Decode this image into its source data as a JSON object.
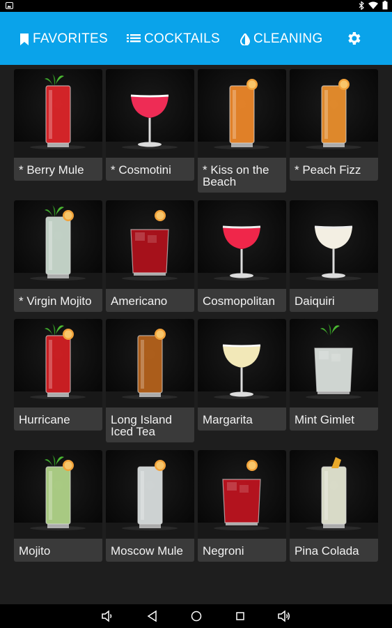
{
  "tabs": [
    {
      "label": "FAVORITES",
      "icon": "bookmark-icon"
    },
    {
      "label": "COCKTAILS",
      "icon": "list-icon"
    },
    {
      "label": "CLEANING",
      "icon": "water-drop-icon"
    }
  ],
  "settings_icon": "gear-icon",
  "colors": {
    "appbar": "#0aa3ea",
    "background": "#1e1e1e",
    "card": "#3a3a3a"
  },
  "cocktails": [
    {
      "name": "* Berry Mule",
      "glass": "highball",
      "liquid": "#e3262a",
      "garnish": "mint"
    },
    {
      "name": "* Cosmotini",
      "glass": "coupe",
      "liquid": "#ee2c55",
      "garnish": "foam"
    },
    {
      "name": "* Kiss on the Beach",
      "glass": "highball",
      "liquid": "#f28a2a",
      "garnish": "orange"
    },
    {
      "name": "* Peach Fizz",
      "glass": "highball",
      "liquid": "#f0932e",
      "garnish": "orange"
    },
    {
      "name": "* Virgin Mojito",
      "glass": "highball",
      "liquid": "#cfe0d4",
      "garnish": "mint-orange"
    },
    {
      "name": "Americano",
      "glass": "rocks",
      "liquid": "#b3111c",
      "garnish": "orange"
    },
    {
      "name": "Cosmopolitan",
      "glass": "coupe",
      "liquid": "#f0264a",
      "garnish": "none"
    },
    {
      "name": "Daiquiri",
      "glass": "coupe",
      "liquid": "#f3efe3",
      "garnish": "none"
    },
    {
      "name": "Hurricane",
      "glass": "highball",
      "liquid": "#d71f24",
      "garnish": "mint-orange"
    },
    {
      "name": "Long Island Iced Tea",
      "glass": "highball",
      "liquid": "#b9641c",
      "garnish": "orange"
    },
    {
      "name": "Margarita",
      "glass": "coupe",
      "liquid": "#f2e8b8",
      "garnish": "salt"
    },
    {
      "name": "Mint Gimlet",
      "glass": "rocks",
      "liquid": "#dfe6e2",
      "garnish": "mint"
    },
    {
      "name": "Mojito",
      "glass": "highball",
      "liquid": "#b5d98c",
      "garnish": "mint-orange"
    },
    {
      "name": "Moscow Mule",
      "glass": "highball",
      "liquid": "#dde3e3",
      "garnish": "orange"
    },
    {
      "name": "Negroni",
      "glass": "rocks",
      "liquid": "#c1141f",
      "garnish": "orange"
    },
    {
      "name": "Pina Colada",
      "glass": "highball",
      "liquid": "#e9ecd7",
      "garnish": "pineapple"
    }
  ],
  "navbar": {
    "icons": [
      "volume-down-icon",
      "back-icon",
      "home-icon",
      "recents-icon",
      "volume-up-icon"
    ]
  }
}
